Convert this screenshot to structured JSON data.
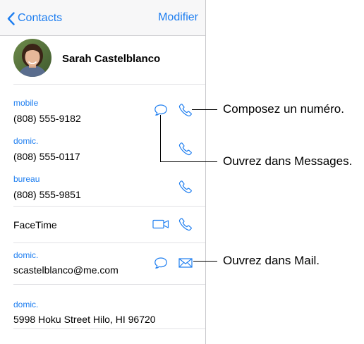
{
  "nav": {
    "back_label": "Contacts",
    "edit_label": "Modifier"
  },
  "contact": {
    "name": "Sarah Castelblanco"
  },
  "phones": [
    {
      "label": "mobile",
      "number": "(808) 555-9182"
    },
    {
      "label": "domic.",
      "number": "(808) 555-0117"
    },
    {
      "label": "bureau",
      "number": "(808) 555-9851"
    }
  ],
  "facetime": {
    "label": "FaceTime"
  },
  "email": {
    "label": "domic.",
    "value": "scastelblanco@me.com"
  },
  "address": {
    "label": "domic.",
    "value": "5998 Hoku Street Hilo, HI 96720"
  },
  "callouts": {
    "call": "Composez un numéro.",
    "messages": "Ouvrez dans Messages.",
    "mail": "Ouvrez dans Mail."
  },
  "colors": {
    "accent": "#1e7ef0",
    "separator": "#e2e2e6",
    "navbar_bg": "#f7f7f8"
  },
  "icons": [
    "chevron-left-icon",
    "message-bubble-icon",
    "phone-icon",
    "video-camera-icon",
    "envelope-icon"
  ]
}
